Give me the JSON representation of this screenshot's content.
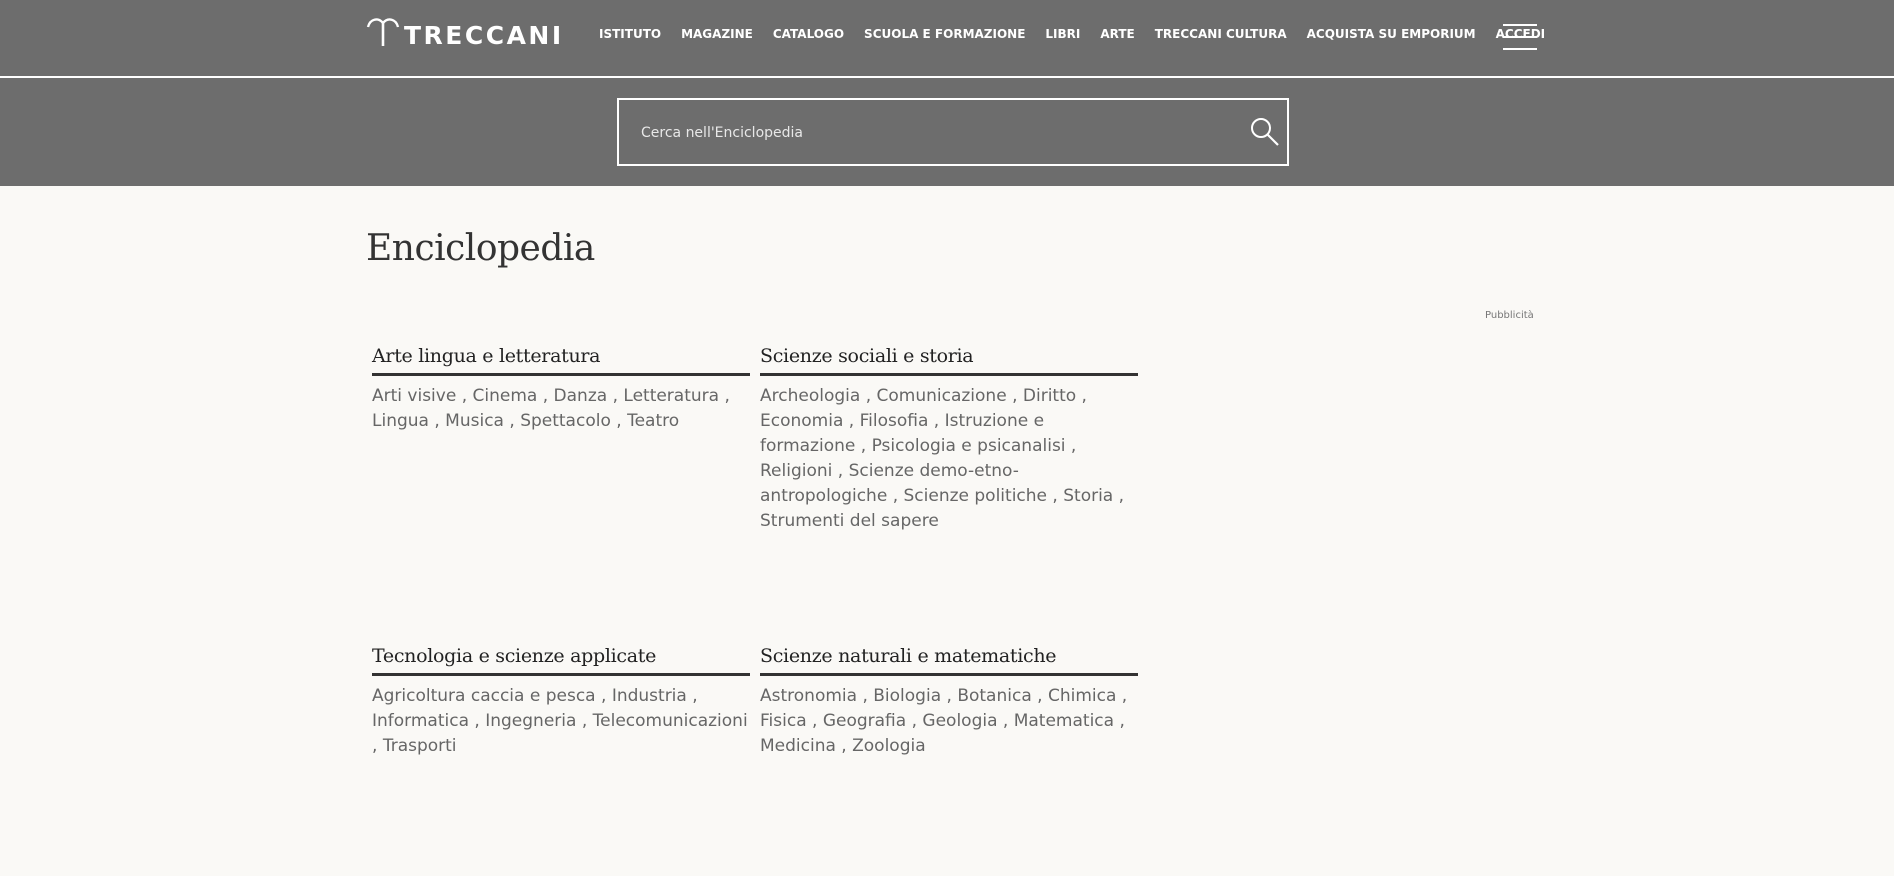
{
  "header": {
    "logo_text": "TRECCANI",
    "nav": [
      {
        "label": "ISTITUTO"
      },
      {
        "label": "MAGAZINE"
      },
      {
        "label": "CATALOGO"
      },
      {
        "label": "SCUOLA E FORMAZIONE"
      },
      {
        "label": "LIBRI"
      },
      {
        "label": "ARTE"
      },
      {
        "label": "TRECCANI CULTURA"
      },
      {
        "label": "ACQUISTA SU EMPORIUM"
      },
      {
        "label": "ACCEDI"
      }
    ],
    "menu_icon": "hamburger-menu-icon"
  },
  "search": {
    "placeholder": "Cerca nell'Enciclopedia",
    "icon": "search-icon"
  },
  "main": {
    "title": "Enciclopedia",
    "ad_label": "Pubblicità"
  },
  "categories": [
    {
      "title": "Arte lingua e letteratura",
      "links": [
        "Arti visive",
        "Cinema",
        "Danza",
        "Letteratura",
        "Lingua",
        "Musica",
        "Spettacolo",
        "Teatro"
      ]
    },
    {
      "title": "Scienze sociali e storia",
      "links": [
        "Archeologia",
        "Comunicazione",
        "Diritto",
        "Economia",
        "Filosofia",
        "Istruzione e formazione",
        "Psicologia e psicanalisi",
        "Religioni",
        "Scienze demo-etno-antropologiche",
        "Scienze politiche",
        "Storia",
        "Strumenti del sapere"
      ]
    },
    {
      "title": "Tecnologia e scienze applicate",
      "links": [
        "Agricoltura caccia e pesca",
        "Industria",
        "Informatica",
        "Ingegneria",
        "Telecomunicazioni",
        "Trasporti"
      ]
    },
    {
      "title": "Scienze naturali e matematiche",
      "links": [
        "Astronomia",
        "Biologia",
        "Botanica",
        "Chimica",
        "Fisica",
        "Geografia",
        "Geologia",
        "Matematica",
        "Medicina",
        "Zoologia"
      ]
    }
  ],
  "colors": {
    "header_bg": "#6d6d6d",
    "page_bg": "#faf9f6",
    "link_text": "#666666",
    "title_text": "#333333"
  }
}
